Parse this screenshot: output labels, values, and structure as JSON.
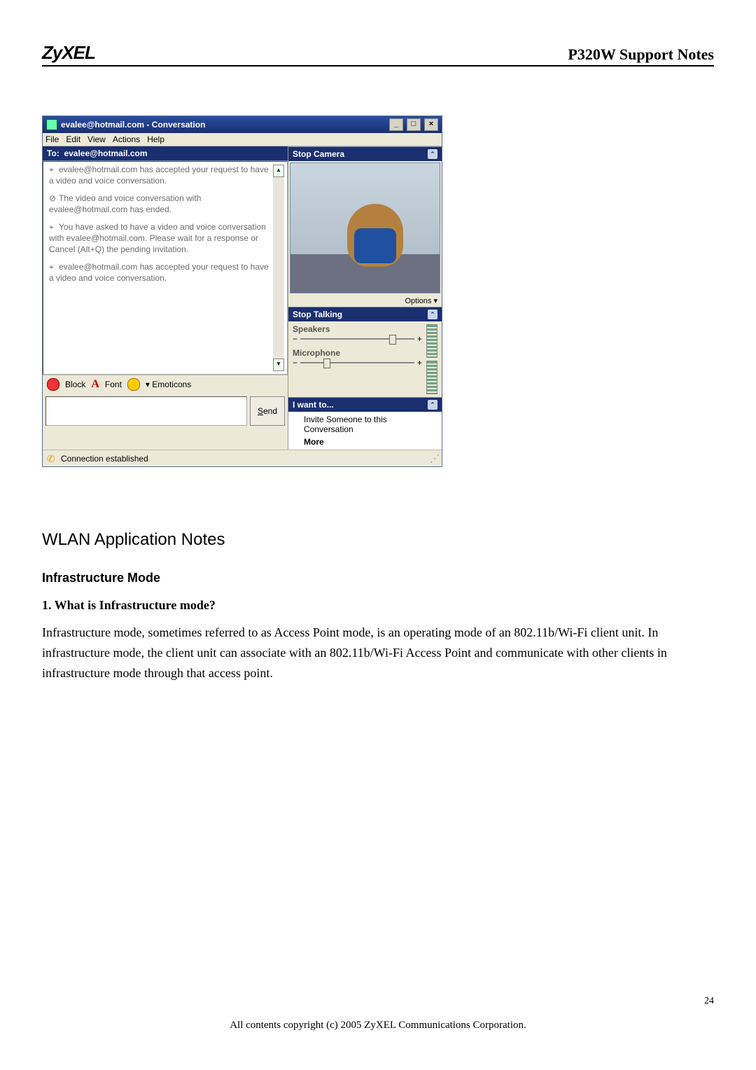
{
  "doc": {
    "logo": "ZyXEL",
    "title": "P320W Support Notes",
    "section": "WLAN Application Notes",
    "sub1": "Infrastructure Mode",
    "sub2": "1. What is Infrastructure mode?",
    "paragraph": "Infrastructure mode, sometimes referred to as Access Point mode, is an operating mode of an 802.11b/Wi-Fi client unit. In infrastructure mode, the client unit can associate with an 802.11b/Wi-Fi Access Point and communicate with other clients in infrastructure mode through that access point.",
    "page_num": "24",
    "footer": "All contents copyright (c) 2005 ZyXEL Communications Corporation."
  },
  "msn": {
    "title": "evalee@hotmail.com - Conversation",
    "menu": {
      "file": "File",
      "edit": "Edit",
      "view": "View",
      "actions": "Actions",
      "help": "Help"
    },
    "to_label": "To:",
    "to_value": "evalee@hotmail.com",
    "messages": {
      "m1": "evalee@hotmail.com has accepted your request to have a video and voice conversation.",
      "m2": "The video and voice conversation with evalee@hotmail.com has ended.",
      "m3": "You have asked to have a video and voice conversation with evalee@hotmail.com. Please wait for a response or Cancel (Alt+Q) the pending invitation.",
      "m4": "evalee@hotmail.com has accepted your request to have a video and voice conversation."
    },
    "format": {
      "block": "Block",
      "font": "Font",
      "emoticons": "Emoticons"
    },
    "send": "Send",
    "right": {
      "stop_camera": "Stop Camera",
      "options": "Options ▾",
      "stop_talking": "Stop Talking",
      "speakers": "Speakers",
      "microphone": "Microphone",
      "iwant": "I want to...",
      "invite": "Invite Someone to this Conversation",
      "more": "More"
    },
    "status": "Connection established"
  }
}
